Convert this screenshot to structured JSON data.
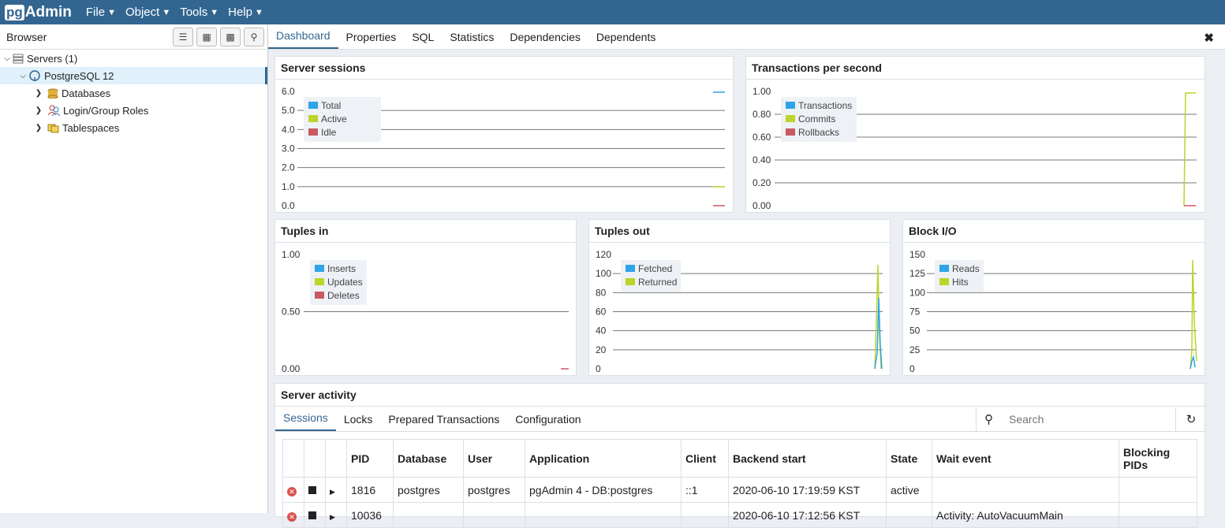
{
  "app": {
    "logo_pg": "pg",
    "logo_admin": "Admin"
  },
  "menu": [
    "File",
    "Object",
    "Tools",
    "Help"
  ],
  "browser": {
    "title": "Browser",
    "tree": [
      {
        "label": "Servers (1)",
        "icon": "servers-icon"
      },
      {
        "label": "PostgreSQL 12",
        "icon": "elephant-icon"
      },
      {
        "label": "Databases",
        "icon": "database-icon"
      },
      {
        "label": "Login/Group Roles",
        "icon": "roles-icon"
      },
      {
        "label": "Tablespaces",
        "icon": "tablespace-icon"
      }
    ]
  },
  "tabs": [
    "Dashboard",
    "Properties",
    "SQL",
    "Statistics",
    "Dependencies",
    "Dependents"
  ],
  "cards": {
    "sessions": {
      "title": "Server sessions",
      "yticks": [
        "6.0",
        "5.0",
        "4.0",
        "3.0",
        "2.0",
        "1.0",
        "0.0"
      ],
      "legend": [
        "Total",
        "Active",
        "Idle"
      ]
    },
    "tps": {
      "title": "Transactions per second",
      "yticks": [
        "1.00",
        "0.80",
        "0.60",
        "0.40",
        "0.20",
        "0.00"
      ],
      "legend": [
        "Transactions",
        "Commits",
        "Rollbacks"
      ]
    },
    "tuples_in": {
      "title": "Tuples in",
      "yticks": [
        "1.00",
        "0.50",
        "0.00"
      ],
      "legend": [
        "Inserts",
        "Updates",
        "Deletes"
      ]
    },
    "tuples_out": {
      "title": "Tuples out",
      "yticks": [
        "120",
        "100",
        "80",
        "60",
        "40",
        "20",
        "0"
      ],
      "legend": [
        "Fetched",
        "Returned"
      ]
    },
    "blockio": {
      "title": "Block I/O",
      "yticks": [
        "150",
        "125",
        "100",
        "75",
        "50",
        "25",
        "0"
      ],
      "legend": [
        "Reads",
        "Hits"
      ]
    }
  },
  "colors": {
    "blue": "#2fa4e7",
    "green": "#bdd42b",
    "red": "#c95a62",
    "brand": "#326690"
  },
  "activity": {
    "title": "Server activity",
    "tabs": [
      "Sessions",
      "Locks",
      "Prepared Transactions",
      "Configuration"
    ],
    "search_placeholder": "Search",
    "columns": [
      "PID",
      "Database",
      "User",
      "Application",
      "Client",
      "Backend start",
      "State",
      "Wait event",
      "Blocking PIDs"
    ],
    "rows": [
      [
        "1816",
        "postgres",
        "postgres",
        "pgAdmin 4 - DB:postgres",
        "::1",
        "2020-06-10 17:19:59 KST",
        "active",
        "",
        ""
      ],
      [
        "10036",
        "",
        "",
        "",
        "",
        "2020-06-10 17:12:56 KST",
        "",
        "Activity: AutoVacuumMain",
        ""
      ]
    ]
  }
}
